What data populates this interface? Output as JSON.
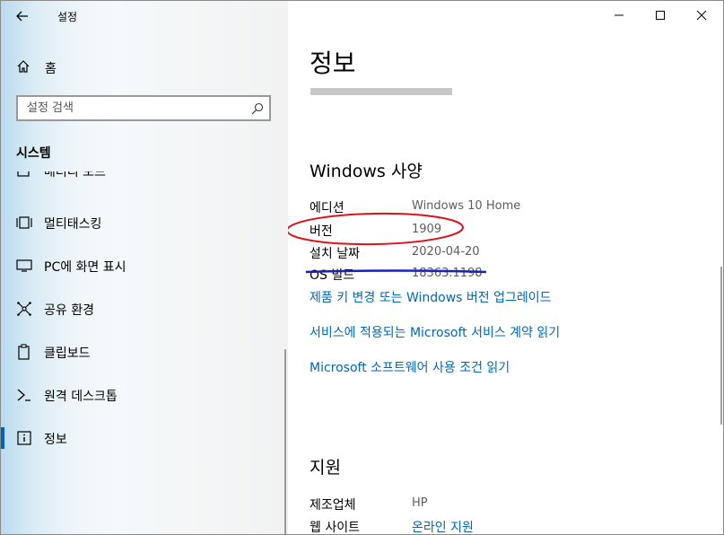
{
  "app": {
    "title": "설정"
  },
  "sidebar": {
    "home_label": "홈",
    "search_placeholder": "설정 검색",
    "section_label": "시스템",
    "partial_item_label": "배터리 모드",
    "items": [
      {
        "label": "멀티태스킹",
        "icon": "multitasking-icon"
      },
      {
        "label": "PC에 화면 표시",
        "icon": "project-icon"
      },
      {
        "label": "공유 환경",
        "icon": "shared-experiences-icon"
      },
      {
        "label": "클립보드",
        "icon": "clipboard-icon"
      },
      {
        "label": "원격 데스크톱",
        "icon": "remote-desktop-icon"
      },
      {
        "label": "정보",
        "icon": "info-icon",
        "selected": true
      }
    ]
  },
  "main": {
    "title": "정보",
    "windows_specs": {
      "heading": "Windows 사양",
      "rows": [
        {
          "label": "에디션",
          "value": "Windows 10 Home"
        },
        {
          "label": "버전",
          "value": "1909"
        },
        {
          "label": "설치 날짜",
          "value": "2020-04-20"
        },
        {
          "label": "OS 빌드",
          "value": "18363.1198"
        }
      ],
      "links": [
        "제품 키 변경 또는 Windows 버전 업그레이드",
        "서비스에 적용되는 Microsoft 서비스 계약 읽기",
        "Microsoft 소프트웨어 사용 조건 읽기"
      ]
    },
    "support": {
      "heading": "지원",
      "manufacturer_label": "제조업체",
      "manufacturer_value": "HP",
      "website_label": "웹 사이트",
      "website_link": "온라인 지원"
    }
  },
  "colors": {
    "accent": "#0067b8",
    "annotation_red": "#d9141b",
    "annotation_blue": "#1a1fbf"
  }
}
